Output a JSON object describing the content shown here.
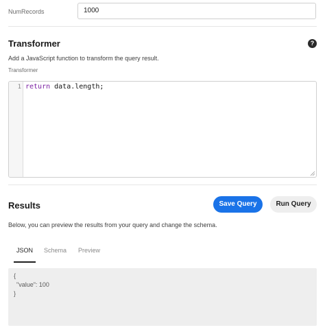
{
  "num_records": {
    "label": "NumRecords",
    "value": "1000"
  },
  "transformer": {
    "title": "Transformer",
    "description": "Add a JavaScript function to transform the query result.",
    "field_label": "Transformer",
    "help_icon": "?",
    "editor": {
      "line_number": "1",
      "keyword": "return",
      "code_rest": " data.length;"
    }
  },
  "results": {
    "title": "Results",
    "save_label": "Save Query",
    "run_label": "Run Query",
    "description": "Below, you can preview the results from your query and change the schema.",
    "tabs": [
      {
        "label": "JSON",
        "active": true
      },
      {
        "label": "Schema",
        "active": false
      },
      {
        "label": "Preview",
        "active": false
      }
    ],
    "output": {
      "open_brace": "{",
      "key": "\"value\"",
      "separator": ": ",
      "value": "100",
      "close_brace": "}"
    }
  },
  "colors": {
    "accent": "#1a73e8",
    "keyword": "#7a1fa2",
    "output_bg": "#eeeeee"
  }
}
